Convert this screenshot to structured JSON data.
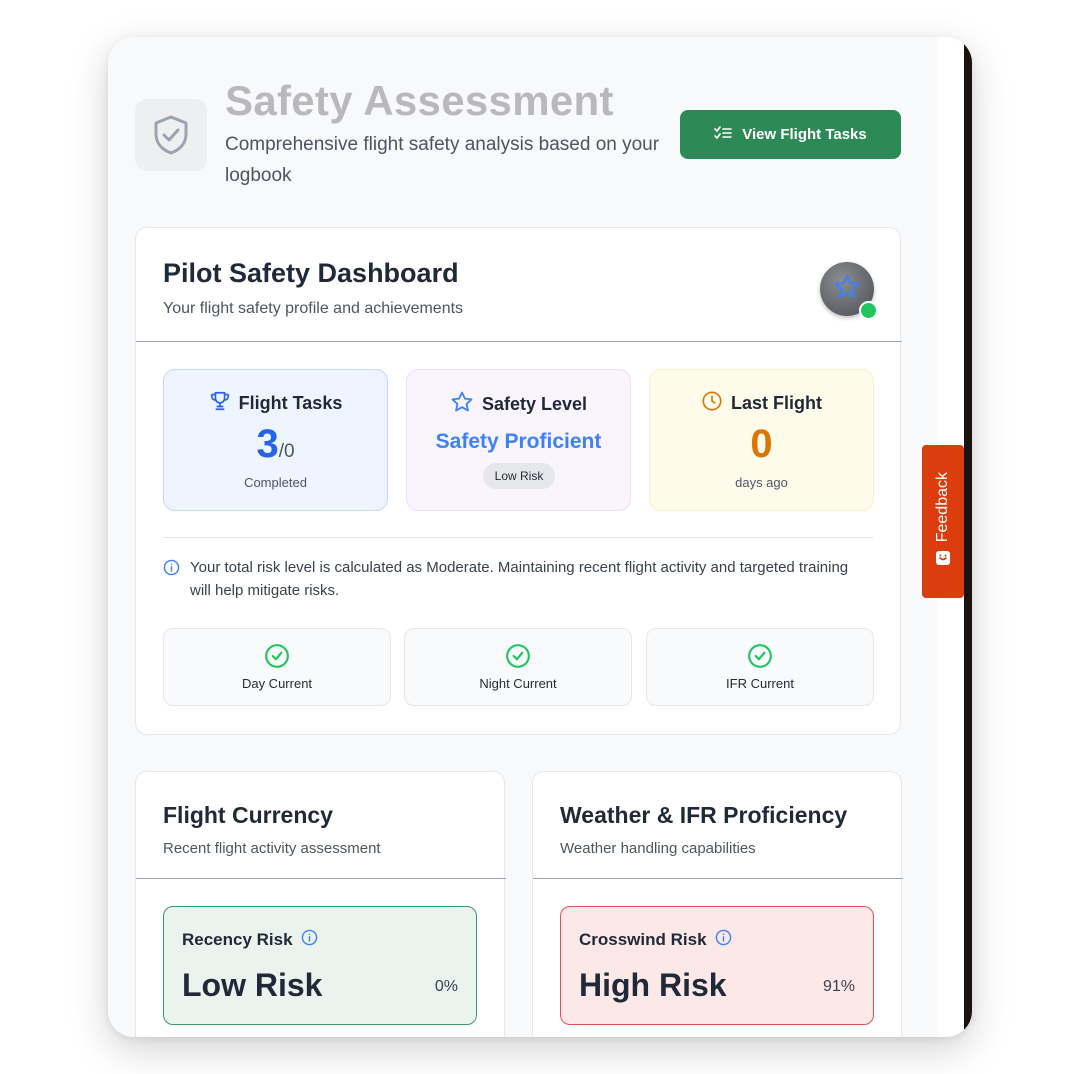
{
  "header": {
    "title": "Safety Assessment",
    "subtitle": "Comprehensive flight safety analysis based on your logbook",
    "button_label": "View Flight Tasks"
  },
  "dashboard": {
    "title": "Pilot Safety Dashboard",
    "subtitle": "Your flight safety profile and achievements",
    "stats": {
      "tasks": {
        "label": "Flight Tasks",
        "value": "3",
        "total": "/0",
        "foot": "Completed"
      },
      "level": {
        "label": "Safety Level",
        "value": "Safety Proficient",
        "badge": "Low Risk"
      },
      "last": {
        "label": "Last Flight",
        "value": "0",
        "foot": "days ago"
      }
    },
    "info_text": "Your total risk level is calculated as Moderate. Maintaining recent flight activity and targeted training will help mitigate risks.",
    "currency": [
      "Day Current",
      "Night Current",
      "IFR Current"
    ]
  },
  "flight_currency": {
    "title": "Flight Currency",
    "subtitle": "Recent flight activity assessment",
    "risk_label": "Recency Risk",
    "risk_level": "Low Risk",
    "risk_pct": "0%"
  },
  "weather": {
    "title": "Weather & IFR Proficiency",
    "subtitle": "Weather handling capabilities",
    "risk_label": "Crosswind Risk",
    "risk_level": "High Risk",
    "risk_pct": "91%"
  },
  "feedback_label": "Feedback",
  "colors": {
    "primary_green": "#2d8a57",
    "accent_blue": "#3b82f6",
    "amber": "#d97706",
    "feedback_red": "#dc3d0f",
    "success": "#22c55e"
  }
}
